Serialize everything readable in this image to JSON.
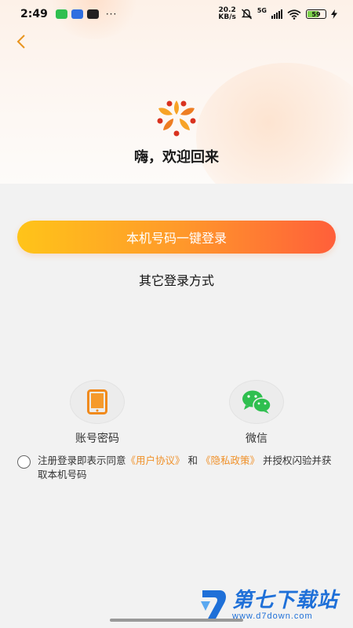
{
  "status_bar": {
    "time": "2:49",
    "net_speed_value": "20.2",
    "net_speed_unit": "KB/s",
    "network_type": "5G",
    "battery": "59",
    "more": "···"
  },
  "header": {
    "welcome_text": "嗨，欢迎回来"
  },
  "login": {
    "one_click_label": "本机号码一键登录",
    "other_methods_label": "其它登录方式",
    "options": [
      {
        "label": "账号密码",
        "icon": "phone-icon"
      },
      {
        "label": "微信",
        "icon": "wechat-icon"
      }
    ]
  },
  "agreement": {
    "prefix": "注册登录即表示同意",
    "user_agreement": "《用户协议》",
    "and": "和",
    "privacy_policy": "《隐私政策》",
    "suffix": "并授权闪验并获取本机号码"
  },
  "watermark": {
    "title": "第七下载站",
    "url": "www.d7down.com"
  },
  "colors": {
    "accent": "#f0912a",
    "button_start": "#ffc419",
    "button_end": "#ff5f3a",
    "wechat_green": "#2fbf4f",
    "watermark_blue": "#1f70d8"
  }
}
